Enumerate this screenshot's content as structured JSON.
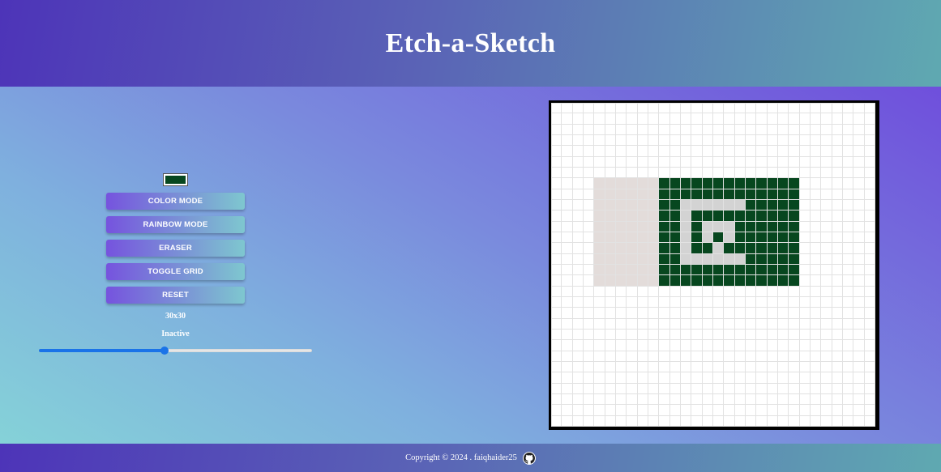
{
  "header": {
    "title": "Etch-a-Sketch"
  },
  "controls": {
    "current_color": "#07471f",
    "buttons": [
      "COLOR MODE",
      "RAINBOW MODE",
      "ERASER",
      "TOGGLE GRID",
      "RESET"
    ],
    "grid_size_label": "30x30",
    "status_label": "Inactive",
    "slider": {
      "min": 1,
      "max": 64,
      "value": 30
    }
  },
  "grid": {
    "size": 30,
    "colors": {
      "dark": "#07471f",
      "gray": "#d3d3d3",
      "pale": "#e3dcda",
      "empty": "#ffffff"
    },
    "rows": [
      "..............................",
      "..............................",
      "..............................",
      "..............................",
      "..............................",
      "..............................",
      "..............................",
      "....pppppp#############.......",
      "....pppppp#############.......",
      "....pppppp##gggggg#####.......",
      "....pppppp##g##########.......",
      "....pppppp##g#ggg######.......",
      "....pppppp##g#g#g######.......",
      "....pppppp##g##g#######.......",
      "....pppppp##gggggg#####.......",
      "....pppppp#############.......",
      "....pppppp#############.......",
      "..............................",
      "..............................",
      "..............................",
      "..............................",
      "..............................",
      "..............................",
      "..............................",
      "..............................",
      "..............................",
      "..............................",
      "..............................",
      "..............................",
      ".............................."
    ]
  },
  "footer": {
    "copyright": "Copyright © 2024 . faiqhaider25",
    "icon": "github-icon"
  }
}
